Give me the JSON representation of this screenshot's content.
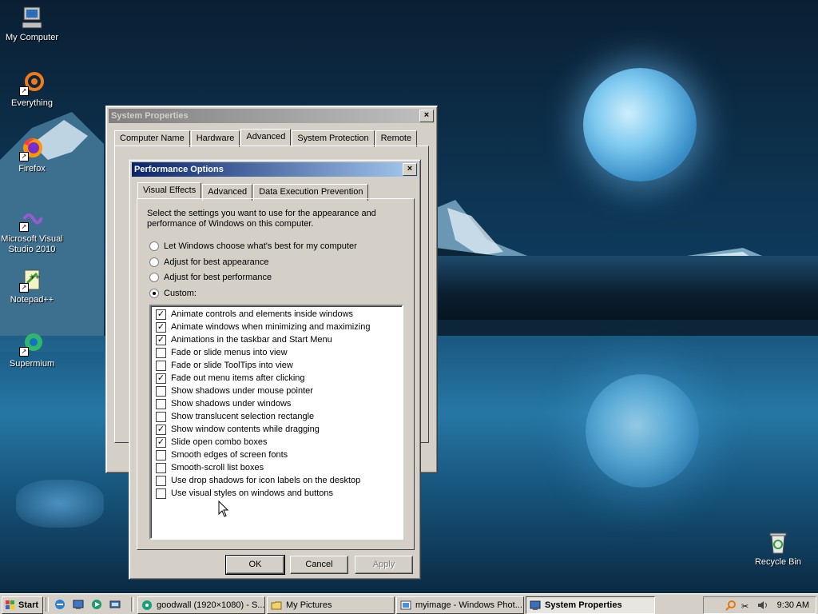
{
  "desktop": {
    "icons": [
      {
        "label": "My Computer"
      },
      {
        "label": "Everything"
      },
      {
        "label": "Firefox"
      },
      {
        "label": "Microsoft Visual Studio 2010"
      },
      {
        "label": "Notepad++"
      },
      {
        "label": "Supermium"
      },
      {
        "label": "Recycle Bin"
      }
    ]
  },
  "system_properties": {
    "title": "System Properties",
    "close": "×",
    "tabs": [
      "Computer Name",
      "Hardware",
      "Advanced",
      "System Protection",
      "Remote"
    ],
    "selected_tab": "Advanced"
  },
  "performance_options": {
    "title": "Performance Options",
    "close": "×",
    "tabs": [
      "Visual Effects",
      "Advanced",
      "Data Execution Prevention"
    ],
    "selected_tab": "Visual Effects",
    "description": "Select the settings you want to use for the appearance and performance of Windows on this computer.",
    "radios": [
      {
        "label": "Let Windows choose what's best for my computer",
        "checked": false
      },
      {
        "label": "Adjust for best appearance",
        "checked": false
      },
      {
        "label": "Adjust for best performance",
        "checked": false
      },
      {
        "label": "Custom:",
        "checked": true
      }
    ],
    "effects": [
      {
        "label": "Animate controls and elements inside windows",
        "checked": true
      },
      {
        "label": "Animate windows when minimizing and maximizing",
        "checked": true
      },
      {
        "label": "Animations in the taskbar and Start Menu",
        "checked": true
      },
      {
        "label": "Fade or slide menus into view",
        "checked": false
      },
      {
        "label": "Fade or slide ToolTips into view",
        "checked": false
      },
      {
        "label": "Fade out menu items after clicking",
        "checked": true
      },
      {
        "label": "Show shadows under mouse pointer",
        "checked": false
      },
      {
        "label": "Show shadows under windows",
        "checked": false
      },
      {
        "label": "Show translucent selection rectangle",
        "checked": false
      },
      {
        "label": "Show window contents while dragging",
        "checked": true
      },
      {
        "label": "Slide open combo boxes",
        "checked": true
      },
      {
        "label": "Smooth edges of screen fonts",
        "checked": false
      },
      {
        "label": "Smooth-scroll list boxes",
        "checked": false
      },
      {
        "label": "Use drop shadows for icon labels on the desktop",
        "checked": false
      },
      {
        "label": "Use visual styles on windows and buttons",
        "checked": false
      }
    ],
    "buttons": {
      "ok": "OK",
      "cancel": "Cancel",
      "apply": "Apply"
    }
  },
  "taskbar": {
    "start": "Start",
    "tasks": [
      {
        "label": "goodwall (1920×1080) - S..."
      },
      {
        "label": "My Pictures"
      },
      {
        "label": "myimage - Windows Phot..."
      },
      {
        "label": "System Properties"
      }
    ],
    "clock": "9:30 AM"
  },
  "colors": {
    "title_active": "#0a246a",
    "title_inactive": "#808080",
    "face": "#d4d0c8"
  }
}
